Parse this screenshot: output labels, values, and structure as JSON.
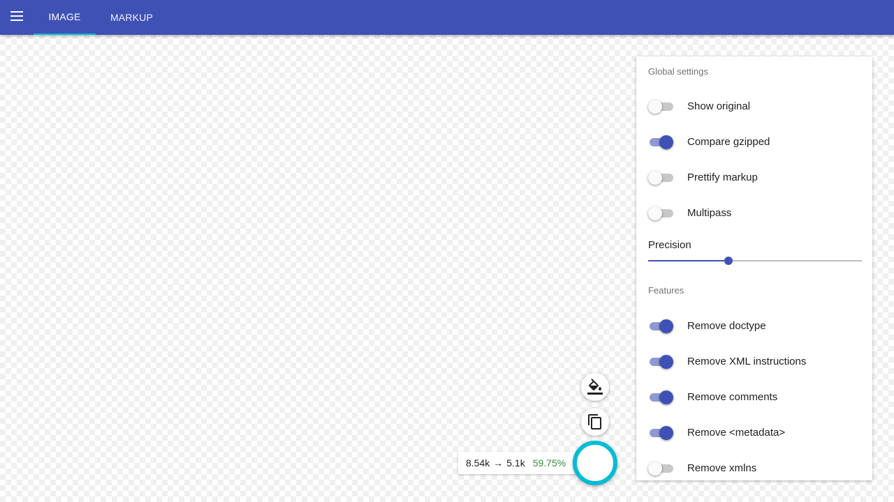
{
  "header": {
    "tabs": [
      {
        "label": "IMAGE",
        "active": true
      },
      {
        "label": "MARKUP",
        "active": false
      }
    ]
  },
  "settings": {
    "global_title": "Global settings",
    "global_options": [
      {
        "label": "Show original",
        "on": false
      },
      {
        "label": "Compare gzipped",
        "on": true
      },
      {
        "label": "Prettify markup",
        "on": false
      },
      {
        "label": "Multipass",
        "on": false
      }
    ],
    "precision_label": "Precision",
    "precision_level": 0.375,
    "features_title": "Features",
    "features": [
      {
        "label": "Remove doctype",
        "on": true
      },
      {
        "label": "Remove XML instructions",
        "on": true
      },
      {
        "label": "Remove comments",
        "on": true
      },
      {
        "label": "Remove <metadata>",
        "on": true
      },
      {
        "label": "Remove xmlns",
        "on": false
      }
    ]
  },
  "results": {
    "original_size": "8.54k",
    "arrow": "→",
    "optimized_size": "5.1k",
    "saving_percent": "59.75%"
  },
  "icons": {
    "menu": "menu-icon",
    "background": "format-color-fill-icon",
    "copy": "content-copy-icon"
  },
  "colors": {
    "primary": "#3f51b5",
    "accent": "#00bcd4",
    "success": "#388e3c"
  }
}
